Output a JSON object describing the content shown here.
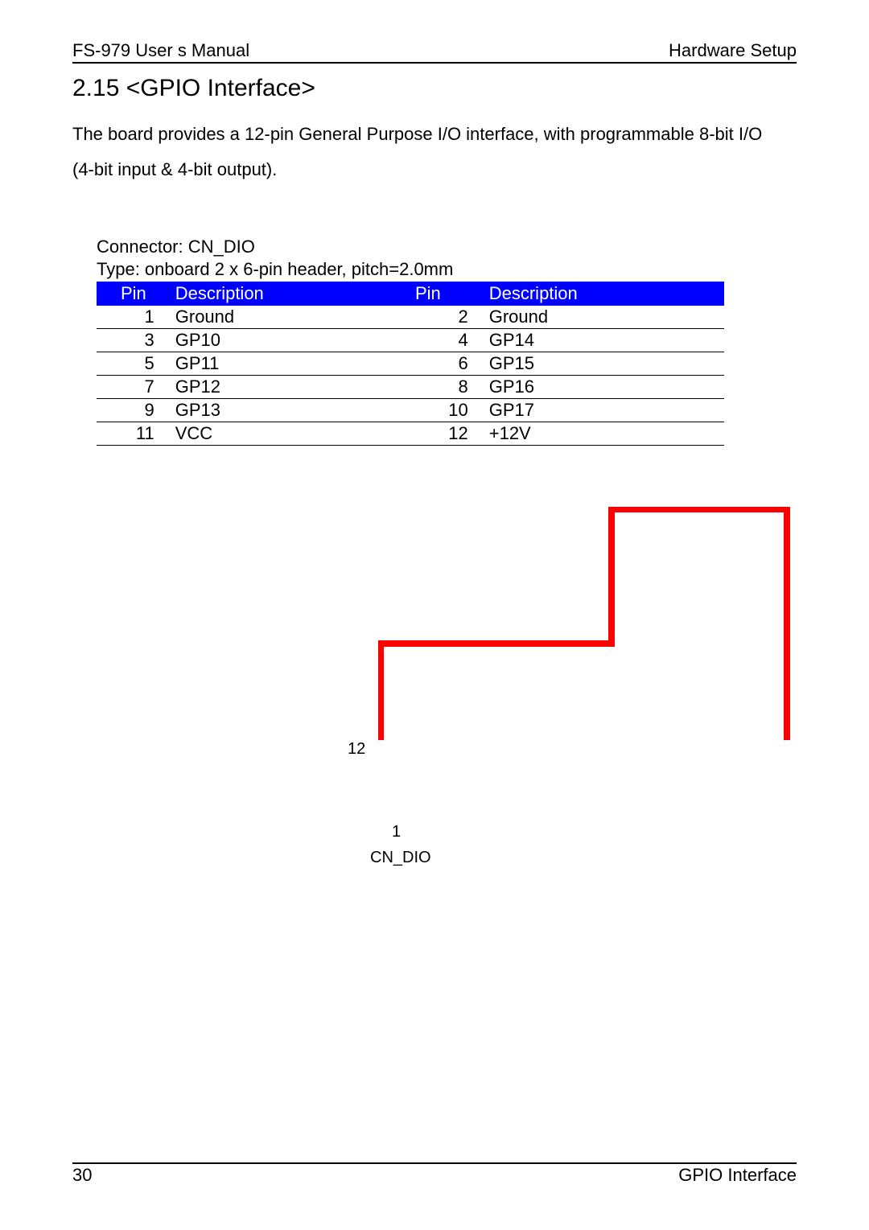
{
  "header": {
    "left": "FS-979 User s Manual",
    "right": "Hardware Setup"
  },
  "section_title": "2.15 <GPIO Interface>",
  "body_line1": "The board provides a 12-pin General Purpose I/O interface, with programmable 8-bit I/O",
  "body_line2": "(4-bit input & 4-bit output).",
  "connector": {
    "line1": "Connector: CN_DIO",
    "line2": "Type: onboard 2 x 6-pin header, pitch=2.0mm"
  },
  "table": {
    "headers": [
      "Pin",
      "Description",
      "Pin",
      "Description"
    ],
    "rows": [
      [
        "1",
        "Ground",
        "2",
        "Ground"
      ],
      [
        "3",
        "GP10",
        "4",
        "GP14"
      ],
      [
        "5",
        "GP11",
        "6",
        "GP15"
      ],
      [
        "7",
        "GP12",
        "8",
        "GP16"
      ],
      [
        "9",
        "GP13",
        "10",
        "GP17"
      ],
      [
        "11",
        "VCC",
        "12",
        "+12V"
      ]
    ]
  },
  "diagram": {
    "num_top": "12",
    "num_bottom": "1",
    "label": "CN_DIO",
    "stroke": "#ff0000"
  },
  "footer": {
    "left": "30",
    "right": "GPIO  Interface"
  }
}
